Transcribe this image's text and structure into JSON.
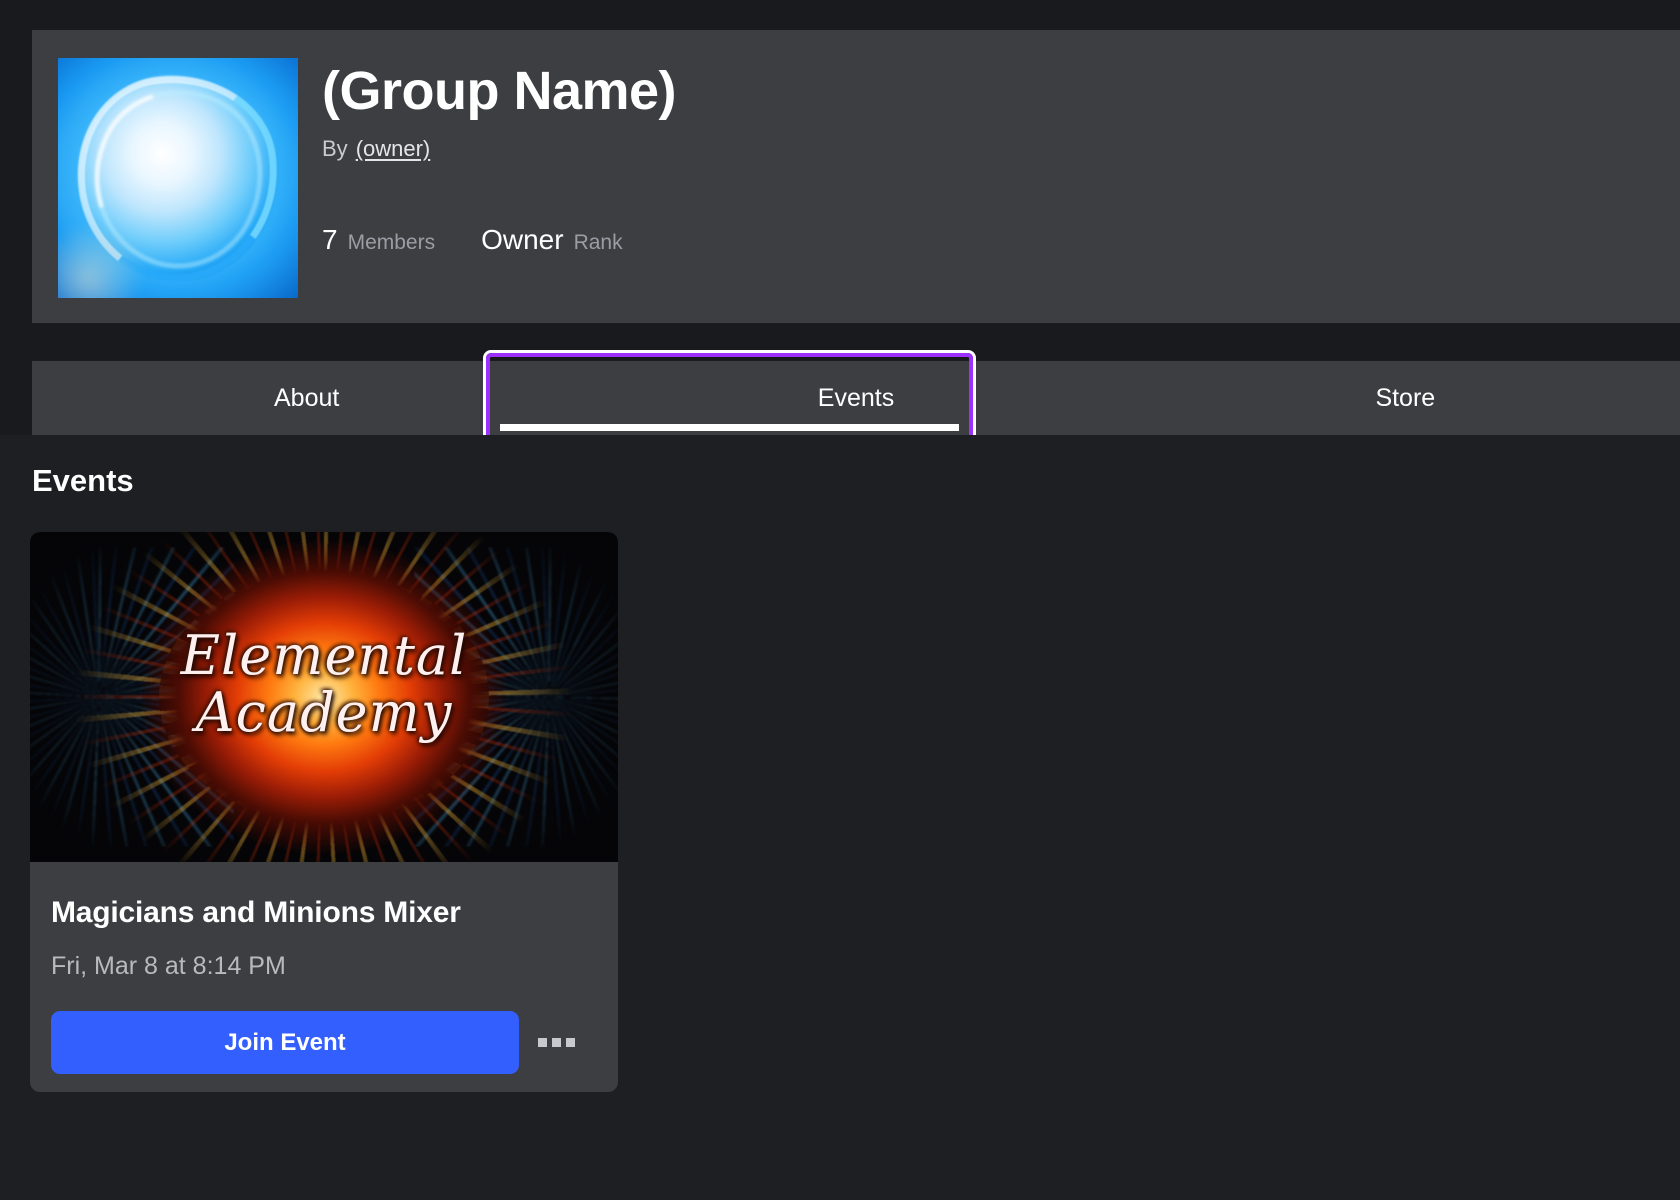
{
  "group": {
    "name": "(Group Name)",
    "by_prefix": "By",
    "owner_link": "(owner)",
    "members_count": "7",
    "members_label": "Members",
    "rank_value": "Owner",
    "rank_label": "Rank",
    "icon_name": "blue-elemental-orb"
  },
  "tabs": {
    "items": [
      {
        "label": "About",
        "active": false
      },
      {
        "label": "Events",
        "active": true
      },
      {
        "label": "Store",
        "active": false
      }
    ],
    "focus_ring_color": "#9b30ff",
    "focused_tab": "Events"
  },
  "events_section": {
    "heading": "Events",
    "cards": [
      {
        "banner_title_line1": "Elemental",
        "banner_title_line2": "Academy",
        "name": "Magicians and Minions Mixer",
        "date": "Fri, Mar 8 at 8:14 PM",
        "join_label": "Join Event",
        "join_color": "#335fff",
        "more_icon": "ellipsis-icon"
      }
    ]
  }
}
